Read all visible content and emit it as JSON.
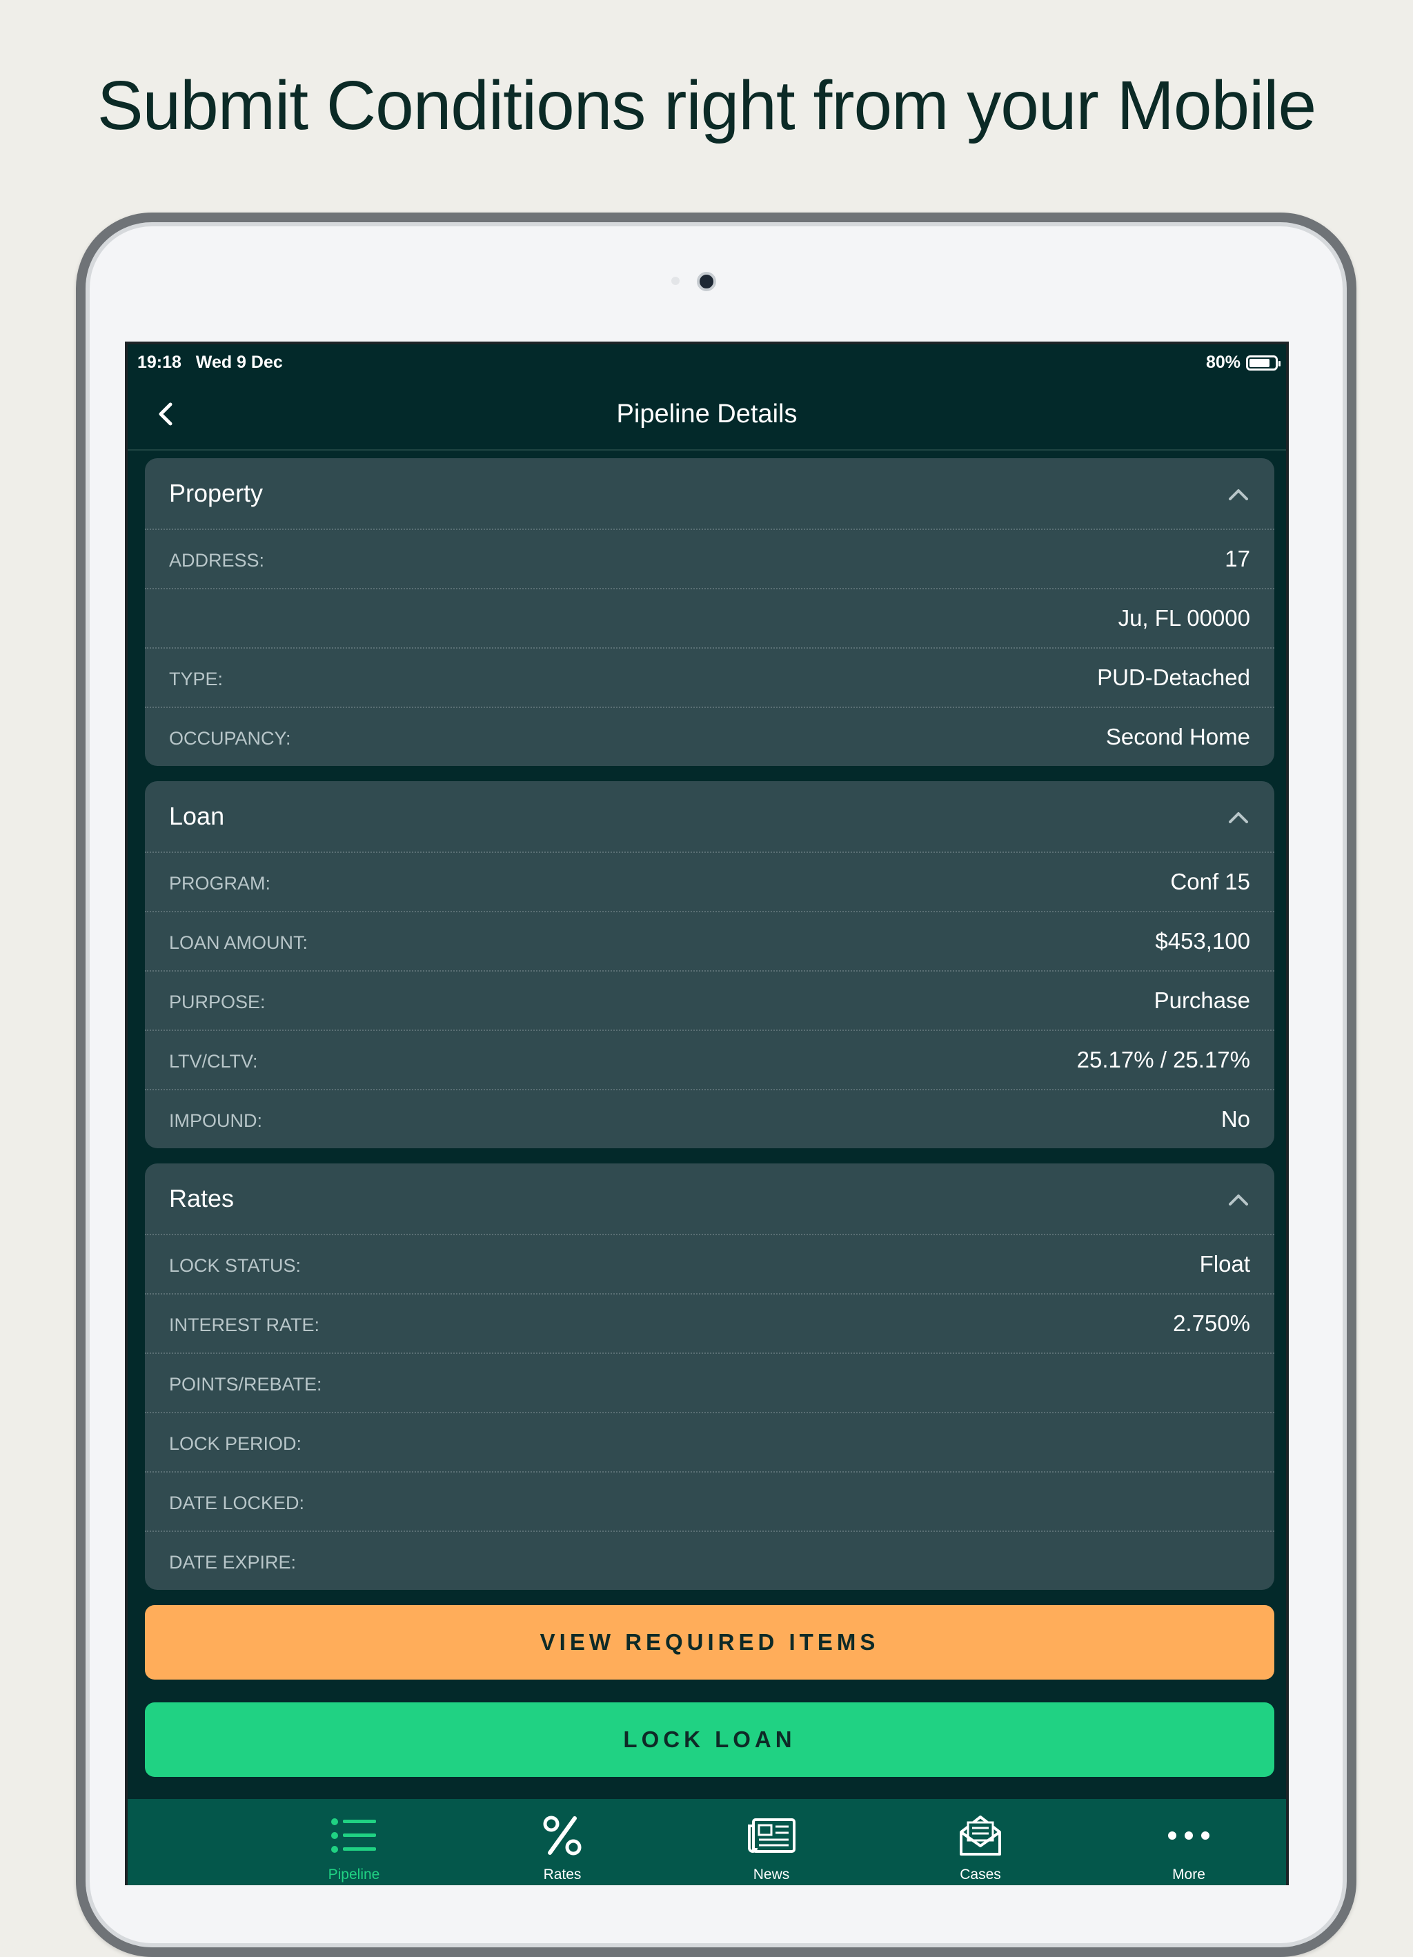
{
  "headline": "Submit Conditions right from your Mobile",
  "status": {
    "time": "19:18",
    "date": "Wed 9 Dec",
    "battery": "80%",
    "battery_level": 0.8
  },
  "nav": {
    "title": "Pipeline Details"
  },
  "property": {
    "title": "Property",
    "address_label": "ADDRESS:",
    "address_line1": "17",
    "address_line2": "Ju, FL 00000",
    "type_label": "TYPE:",
    "type_value": "PUD-Detached",
    "occupancy_label": "OCCUPANCY:",
    "occupancy_value": "Second Home"
  },
  "loan": {
    "title": "Loan",
    "program_label": "PROGRAM:",
    "program_value": "Conf 15",
    "amount_label": "LOAN AMOUNT:",
    "amount_value": "$453,100",
    "purpose_label": "PURPOSE:",
    "purpose_value": "Purchase",
    "ltv_label": "LTV/CLTV:",
    "ltv_value": "25.17% / 25.17%",
    "impound_label": "IMPOUND:",
    "impound_value": "No"
  },
  "rates": {
    "title": "Rates",
    "lock_status_label": "LOCK STATUS:",
    "lock_status_value": "Float",
    "interest_label": "INTEREST RATE:",
    "interest_value": "2.750%",
    "points_label": "POINTS/REBATE:",
    "points_value": "",
    "lock_period_label": "LOCK PERIOD:",
    "lock_period_value": "",
    "date_locked_label": "DATE LOCKED:",
    "date_locked_value": "",
    "date_expire_label": "DATE EXPIRE:",
    "date_expire_value": ""
  },
  "buttons": {
    "view_required": "VIEW REQUIRED ITEMS",
    "lock_loan": "LOCK LOAN"
  },
  "tabs": [
    {
      "label": "Pipeline",
      "icon": "list-icon",
      "active": true
    },
    {
      "label": "Rates",
      "icon": "percent-icon",
      "active": false
    },
    {
      "label": "News",
      "icon": "newspaper-icon",
      "active": false
    },
    {
      "label": "Cases",
      "icon": "envelope-icon",
      "active": false
    },
    {
      "label": "More",
      "icon": "more-icon",
      "active": false
    }
  ],
  "colors": {
    "background": "#efeee9",
    "app_bg": "#03292a",
    "card": "#314b50",
    "accent_green": "#20d283",
    "accent_orange": "#ffad5a",
    "tabbar": "#04574b"
  }
}
